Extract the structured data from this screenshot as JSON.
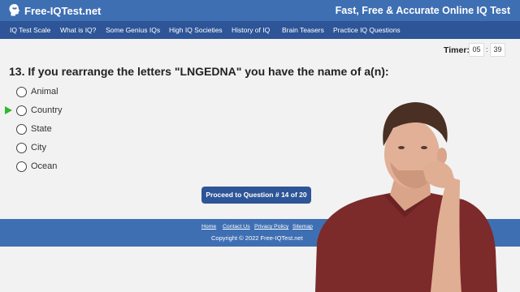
{
  "header": {
    "logo_icon": "brain-head-icon",
    "site_title": "Free-IQTest.net",
    "tagline": "Fast, Free & Accurate Online IQ Test"
  },
  "nav": {
    "items": [
      {
        "label": "IQ Test Scale"
      },
      {
        "label": "What is IQ?"
      },
      {
        "label": "Some Genius IQs"
      },
      {
        "label": "High IQ Societies"
      },
      {
        "label": "History of IQ"
      },
      {
        "label": "Brain Teasers"
      },
      {
        "label": "Practice IQ Questions"
      }
    ]
  },
  "timer": {
    "label": "Timer:",
    "minutes": "05",
    "separator": ":",
    "seconds": "39"
  },
  "question": {
    "text": "13. If you rearrange the letters \"LNGEDNA\" you have the name of a(n):",
    "options": [
      {
        "label": "Animal"
      },
      {
        "label": "Country"
      },
      {
        "label": "State"
      },
      {
        "label": "City"
      },
      {
        "label": "Ocean"
      }
    ]
  },
  "proceed_button": {
    "label": "Proceed to Question # 14 of 20"
  },
  "footer": {
    "links": [
      {
        "label": "Home"
      },
      {
        "label": "Contact Us"
      },
      {
        "label": "Privacy Policy"
      },
      {
        "label": "Sitemap"
      }
    ],
    "copyright": "Copyright © 2022 Free-IQTest.net"
  },
  "colors": {
    "header_bg": "#3f6fb3",
    "nav_bg": "#2d5597",
    "button_bg": "#2d5597",
    "marker": "#2eb82e",
    "page_bg": "#f2f2f2"
  }
}
